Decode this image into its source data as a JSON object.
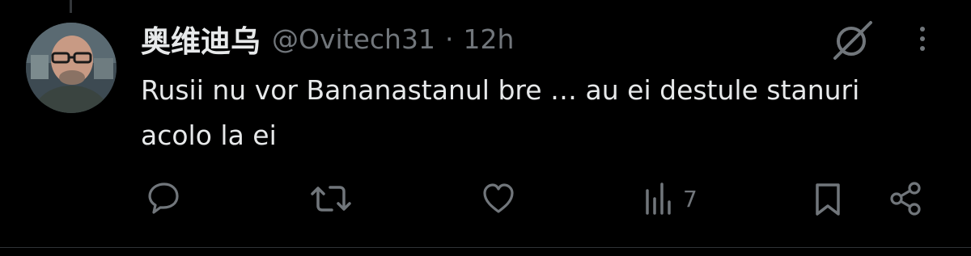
{
  "tweet": {
    "display_name": "奥维迪乌",
    "handle": "@Ovitech31",
    "separator": "·",
    "time": "12h",
    "text": "Rusii nu vor Bananastanul bre … au ei destule stanuri acolo la ei"
  },
  "actions": {
    "reply_icon": "reply-icon",
    "retweet_icon": "retweet-icon",
    "like_icon": "heart-icon",
    "views_icon": "views-icon",
    "views_count": "7",
    "bookmark_icon": "bookmark-icon",
    "share_icon": "share-icon"
  },
  "colors": {
    "background": "#000000",
    "text": "#e7e9ea",
    "muted": "#71767b"
  }
}
